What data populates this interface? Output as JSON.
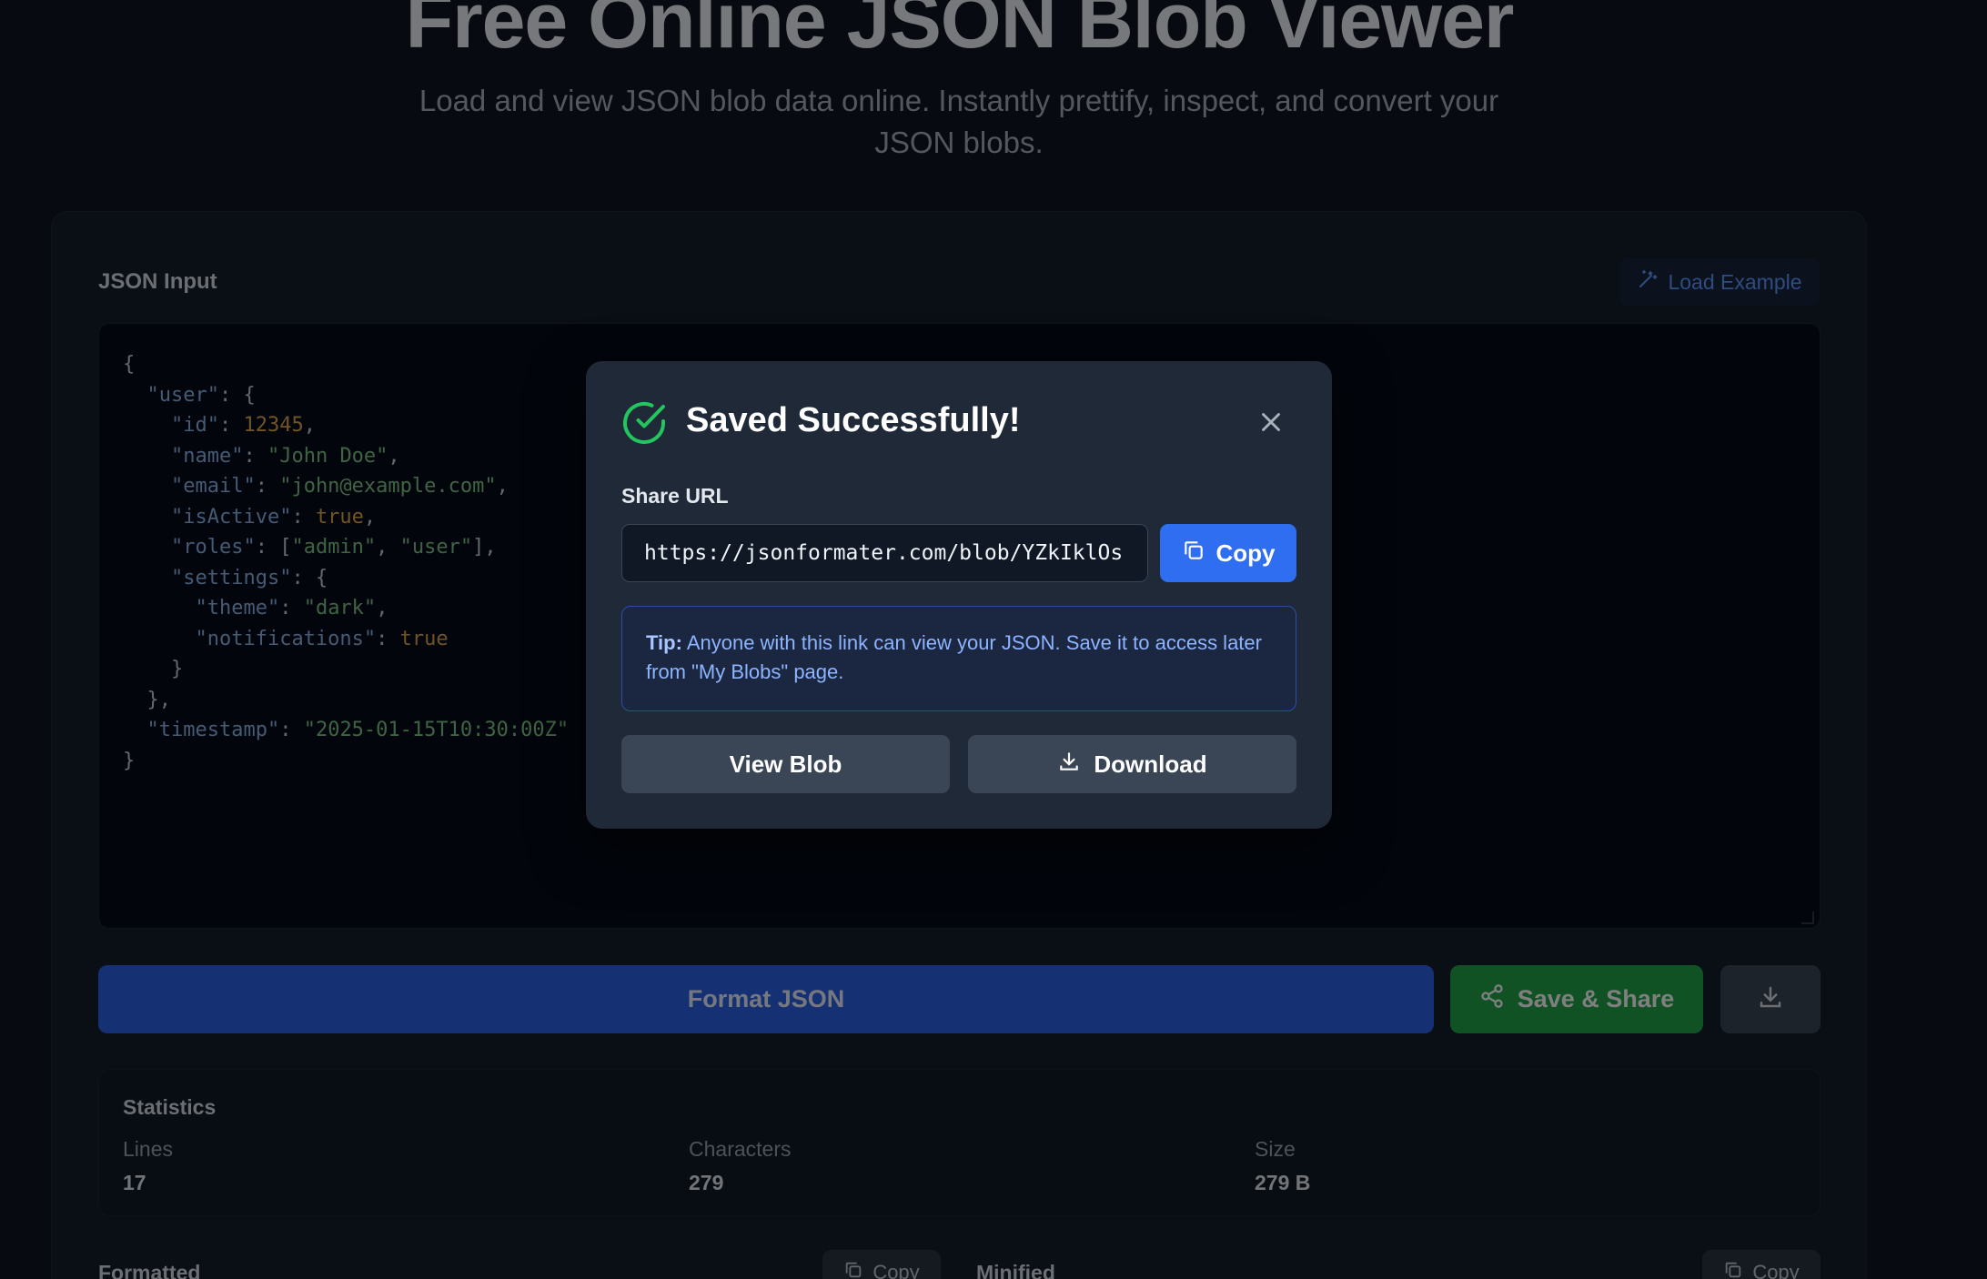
{
  "hero": {
    "title": "Free Online JSON Blob Viewer",
    "subtitle": "Load and view JSON blob data online. Instantly prettify, inspect, and convert your JSON blobs."
  },
  "input": {
    "label": "JSON Input",
    "load_example": "Load Example",
    "lines": [
      "{",
      "  \"user\": {",
      "    \"id\": 12345,",
      "    \"name\": \"John Doe\",",
      "    \"email\": \"john@example.com\",",
      "    \"isActive\": true,",
      "    \"roles\": [\"admin\", \"user\"],",
      "    \"settings\": {",
      "      \"theme\": \"dark\",",
      "      \"notifications\": true",
      "    }",
      "  },",
      "  \"timestamp\": \"2025-01-15T10:30:00Z\"",
      "}"
    ]
  },
  "actions": {
    "format": "Format JSON",
    "save_share": "Save & Share"
  },
  "stats": {
    "title": "Statistics",
    "items": [
      {
        "label": "Lines",
        "value": "17"
      },
      {
        "label": "Characters",
        "value": "279"
      },
      {
        "label": "Size",
        "value": "279 B"
      }
    ]
  },
  "bottom": {
    "formatted_label": "Formatted",
    "minified_label": "Minified",
    "copy_label": "Copy"
  },
  "modal": {
    "title": "Saved Successfully!",
    "share_label": "Share URL",
    "share_url": "https://jsonformater.com/blob/YZkIklOs",
    "copy": "Copy",
    "tip_bold": "Tip:",
    "tip_text": " Anyone with this link can view your JSON. Save it to access later from \"My Blobs\" page.",
    "view_blob": "View Blob",
    "download": "Download"
  },
  "colors": {
    "background": "#0f1622",
    "primary": "#2f6df1",
    "success": "#22a54a",
    "modal_bg": "#1f2937"
  }
}
